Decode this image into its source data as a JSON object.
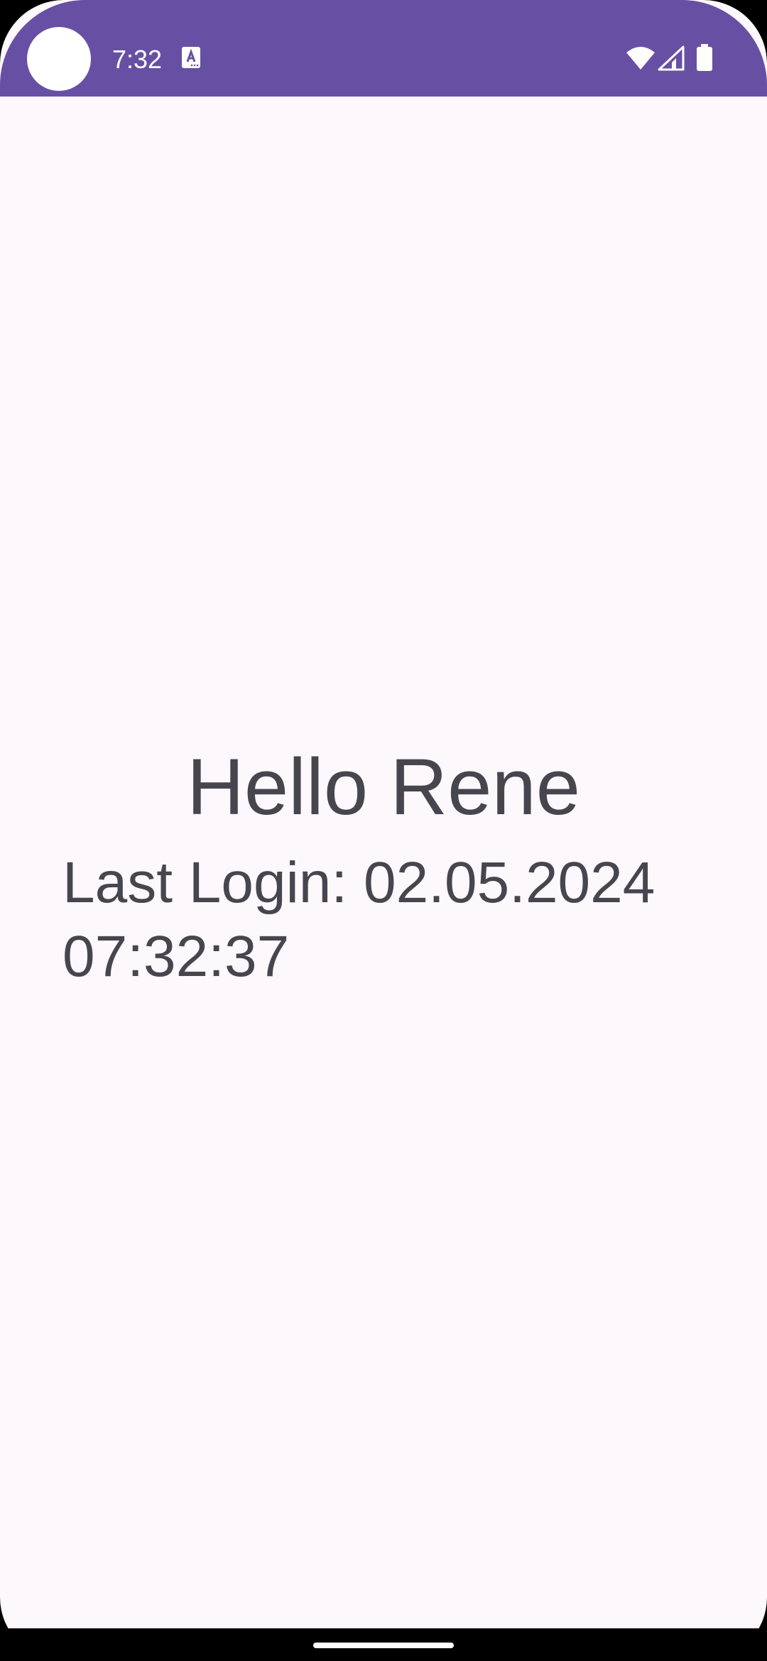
{
  "status_bar": {
    "time": "7:32",
    "icons": [
      "camera-cutout",
      "notification-a-icon",
      "wifi-icon",
      "cell-signal-icon",
      "battery-icon"
    ],
    "background_color": "#6750a4",
    "foreground_color": "#ffffff"
  },
  "main": {
    "greeting": "Hello Rene",
    "last_login": "Last Login: 02.05.2024\n07:32:37",
    "text_color": "#47454e",
    "background_color": "#fdf8fc"
  },
  "nav_bar": {
    "handle": "home-handle"
  }
}
